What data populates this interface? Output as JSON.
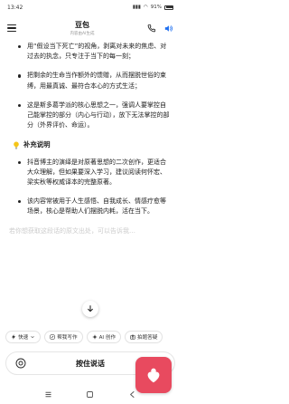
{
  "status_bar": {
    "time": "13:42",
    "battery": "91%"
  },
  "header": {
    "title": "豆包",
    "subtitle": "内容由AI生成"
  },
  "content": {
    "bullets_top": [
      "用“假设当下死亡”的视角，剥离对未来的焦虑、对过去的执念，只专注于当下的每一刻；",
      "把剩余的生命当作额外的馈赠，从而摆脱世俗的束缚，用最真诚、最符合本心的方式生活；",
      "这是斯多葛学派的核心思想之一，强调人要掌控自己能掌控的部分（内心与行动），放下无法掌控的部分（外界评价、命运）。"
    ],
    "section_title": "补充说明",
    "bullets_bottom": [
      "抖音博主的演绎是对原著思想的二次创作，更适合大众理解，但如果要深入学习，建议阅读何怀宏、梁实秋等权威译本的完整原著。",
      "该内容常被用于人生感悟、自我成长、情感疗愈等场景，核心是帮助人们摆脱内耗，活在当下。"
    ],
    "fade_line": "若你想获取这段话的原文出处，可以告诉我…"
  },
  "chips": [
    {
      "icon": "lightning-icon",
      "label": "快速"
    },
    {
      "icon": "pen-icon",
      "label": "帮我写作"
    },
    {
      "icon": "sparkle-icon",
      "label": "AI 创作"
    },
    {
      "icon": "camera-icon",
      "label": "拍题答疑"
    }
  ],
  "composer": {
    "label": "按住说话"
  },
  "colors": {
    "accent": "#1e6ff0",
    "floating_app": "#e84a5f"
  }
}
